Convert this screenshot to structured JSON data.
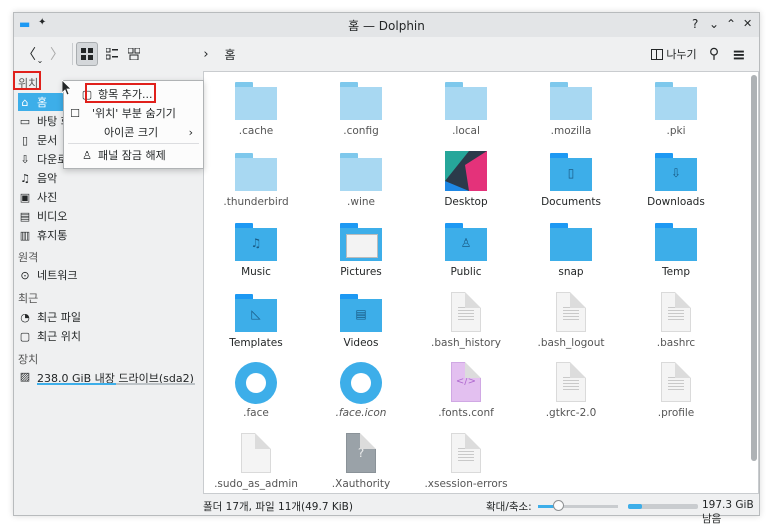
{
  "window": {
    "title": "홈 — Dolphin"
  },
  "titlebar": {
    "help": "?",
    "minimize": "⌄",
    "maximize": "⌃",
    "close": "✕",
    "app_icon": "▬",
    "pin": "✦"
  },
  "toolbar": {
    "back": "〈",
    "back_dd": "⌄",
    "forward": "〉",
    "breadcrumb_arrow": "›",
    "breadcrumb": "홈",
    "split_label": "나누기",
    "search": "⚲",
    "menu": "≡"
  },
  "sidebar": {
    "places_header": "위치",
    "places": [
      {
        "icon": "⌂",
        "label": "홈"
      },
      {
        "icon": "▭",
        "label": "바탕 화"
      },
      {
        "icon": "▯",
        "label": "문서"
      },
      {
        "icon": "⇩",
        "label": "다운로"
      },
      {
        "icon": "♫",
        "label": "음악"
      },
      {
        "icon": "▣",
        "label": "사진"
      },
      {
        "icon": "▤",
        "label": "비디오"
      },
      {
        "icon": "▥",
        "label": "휴지통"
      }
    ],
    "remote_header": "원격",
    "remote": [
      {
        "icon": "⊙",
        "label": "네트워크"
      }
    ],
    "recent_header": "최근",
    "recent": [
      {
        "icon": "◔",
        "label": "최근 파일"
      },
      {
        "icon": "▢",
        "label": "최근 위치"
      }
    ],
    "devices_header": "장치",
    "devices": [
      {
        "icon": "▨",
        "label": "238.0 GiB 내장 드라이브(sda2)",
        "usage_fraction": 0.5
      }
    ]
  },
  "context_menu": {
    "items": [
      {
        "icon": "▢",
        "label": "항목 추가..."
      },
      {
        "icon": "☐",
        "label": "'위치' 부분 숨기기"
      },
      {
        "icon": "",
        "label": "아이콘 크기",
        "arrow": "›"
      },
      {
        "icon": "♙",
        "label": "패널 잠금 해제"
      }
    ]
  },
  "files": [
    {
      "name": ".cache",
      "kind": "folder-light"
    },
    {
      "name": ".config",
      "kind": "folder-light"
    },
    {
      "name": ".local",
      "kind": "folder-light"
    },
    {
      "name": ".mozilla",
      "kind": "folder-light"
    },
    {
      "name": ".pki",
      "kind": "folder-light"
    },
    {
      "name": ".thunderbird",
      "kind": "folder-light"
    },
    {
      "name": ".wine",
      "kind": "folder-light"
    },
    {
      "name": "Desktop",
      "kind": "desktop"
    },
    {
      "name": "Documents",
      "kind": "folder",
      "glyph": "▯"
    },
    {
      "name": "Downloads",
      "kind": "folder",
      "glyph": "⇩"
    },
    {
      "name": "Music",
      "kind": "folder",
      "glyph": "♫"
    },
    {
      "name": "Pictures",
      "kind": "pictures"
    },
    {
      "name": "Public",
      "kind": "folder",
      "glyph": "♙"
    },
    {
      "name": "snap",
      "kind": "folder",
      "glyph": ""
    },
    {
      "name": "Temp",
      "kind": "folder",
      "glyph": ""
    },
    {
      "name": "Templates",
      "kind": "folder",
      "glyph": "◺"
    },
    {
      "name": "Videos",
      "kind": "folder",
      "glyph": "▤"
    },
    {
      "name": ".bash_history",
      "kind": "doc"
    },
    {
      "name": ".bash_logout",
      "kind": "doc"
    },
    {
      "name": ".bashrc",
      "kind": "doc"
    },
    {
      "name": ".face",
      "kind": "gear"
    },
    {
      "name": ".face.icon",
      "kind": "gear",
      "italic": true
    },
    {
      "name": ".fonts.conf",
      "kind": "xml"
    },
    {
      "name": ".gtkrc-2.0",
      "kind": "doc"
    },
    {
      "name": ".profile",
      "kind": "doc"
    },
    {
      "name": ".sudo_as_admin",
      "kind": "blank"
    },
    {
      "name": ".Xauthority",
      "kind": "unknown"
    },
    {
      "name": ".xsession-errors",
      "kind": "doc"
    }
  ],
  "status": {
    "summary": "폴더 17개, 파일 11개(49.7 KiB)",
    "zoom_label": "확대/축소:",
    "free_space": "197.3 GiB 남음",
    "zoom_fraction": 0.25,
    "used_fraction": 0.2
  }
}
